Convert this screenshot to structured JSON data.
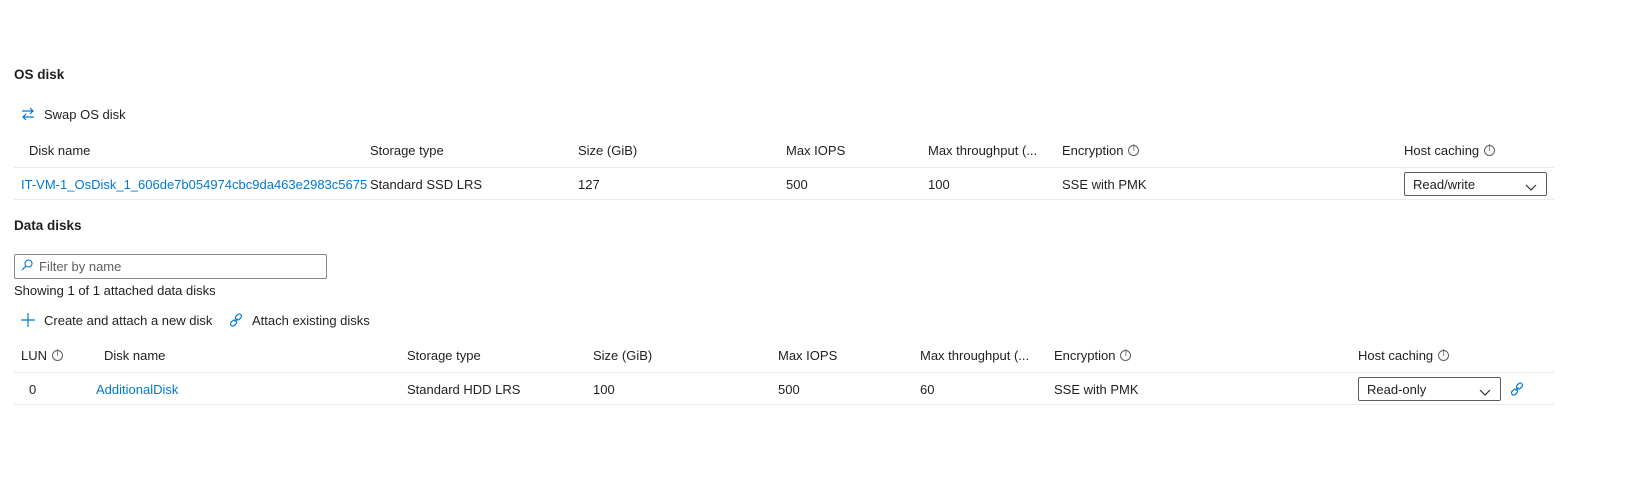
{
  "os_disk": {
    "title": "OS disk",
    "swap_label": "Swap OS disk",
    "columns": [
      "Disk name",
      "Storage type",
      "Size (GiB)",
      "Max IOPS",
      "Max throughput (...",
      "Encryption",
      "Host caching"
    ],
    "row": {
      "disk_name": "IT-VM-1_OsDisk_1_606de7b054974cbc9da463e2983c5675",
      "storage_type": "Standard SSD LRS",
      "size": "127",
      "max_iops": "500",
      "max_throughput": "100",
      "encryption": "SSE with PMK",
      "host_caching": "Read/write"
    }
  },
  "data_disks": {
    "title": "Data disks",
    "filter_placeholder": "Filter by name",
    "showing_text": "Showing 1 of 1 attached data disks",
    "create_label": "Create and attach a new disk",
    "attach_label": "Attach existing disks",
    "columns": [
      "LUN",
      "Disk name",
      "Storage type",
      "Size (GiB)",
      "Max IOPS",
      "Max throughput (...",
      "Encryption",
      "Host caching"
    ],
    "row": {
      "lun": "0",
      "disk_name": "AdditionalDisk",
      "storage_type": "Standard HDD LRS",
      "size": "100",
      "max_iops": "500",
      "max_throughput": "60",
      "encryption": "SSE with PMK",
      "host_caching": "Read-only"
    }
  },
  "icons": {
    "swap": "swap-icon",
    "filter": "search-icon",
    "create": "plus-icon",
    "attach": "link-icon",
    "info": "info-icon",
    "chevron": "chevron-down-icon",
    "detach": "detach-icon"
  },
  "colors": {
    "accent": "#0078d4",
    "text": "#201f1e",
    "divider": "#edebe9",
    "border": "#605e5c"
  }
}
